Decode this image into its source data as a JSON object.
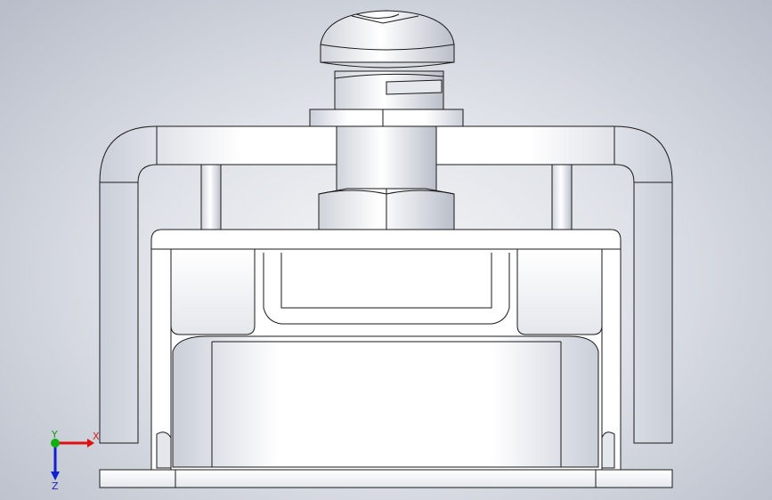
{
  "viewport": {
    "background_center": "#f4f5f7",
    "background_edge": "#b7bcc8"
  },
  "model": {
    "parts": [
      "screw-head",
      "screw-thread",
      "washer",
      "bracket",
      "nut",
      "bolt-shaft",
      "clamp-frame",
      "relay-body",
      "base-plate"
    ],
    "edge_color": "#1a1a1a",
    "face_color": "#ffffff",
    "shade_color": "#c9ced8"
  },
  "triad": {
    "x_label": "X",
    "y_label": "Y",
    "z_label": "Z",
    "x_color": "#e01010",
    "y_color": "#10b010",
    "z_color": "#1020d0"
  }
}
